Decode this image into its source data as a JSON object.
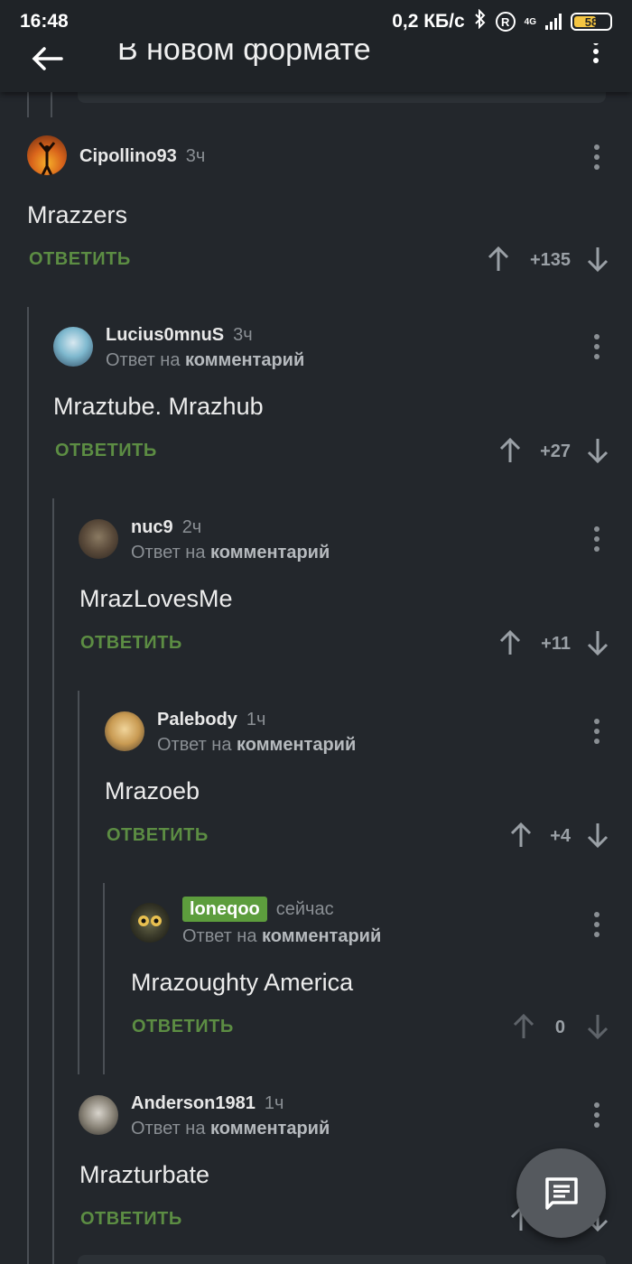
{
  "status": {
    "time": "16:48",
    "net_speed": "0,2 КБ/с",
    "network": "4G",
    "battery": "58"
  },
  "app_bar": {
    "title": "В новом формате"
  },
  "reply_label": "ОТВЕТИТЬ",
  "reply_to_prefix": "Ответ на",
  "reply_to_link": "комментарий",
  "comments": [
    {
      "user": "Cipollino93",
      "time": "3ч",
      "text": "Mrazzers",
      "score": "+135",
      "is_reply": false
    },
    {
      "user": "Lucius0mnuS",
      "time": "3ч",
      "text": "Mraztube. Mrazhub",
      "score": "+27",
      "is_reply": true
    },
    {
      "user": "nuc9",
      "time": "2ч",
      "text": "MrazLovesMe",
      "score": "+11",
      "is_reply": true
    },
    {
      "user": "Palebody",
      "time": "1ч",
      "text": "Mrazoeb",
      "score": "+4",
      "is_reply": true
    },
    {
      "user": "loneqoo",
      "time": "сейчас",
      "text": "Mrazoughty America",
      "score": "0",
      "is_reply": true,
      "own": true
    },
    {
      "user": "Anderson1981",
      "time": "1ч",
      "text": "Mrazturbate",
      "score": "",
      "is_reply": true
    }
  ],
  "colors": {
    "background": "#23272c",
    "accent_green": "#5c8d43",
    "own_badge": "#5d9d3d"
  },
  "icons": [
    "back-arrow-icon",
    "more-vert-icon",
    "arrow-up-icon",
    "arrow-down-icon",
    "comment-icon"
  ]
}
